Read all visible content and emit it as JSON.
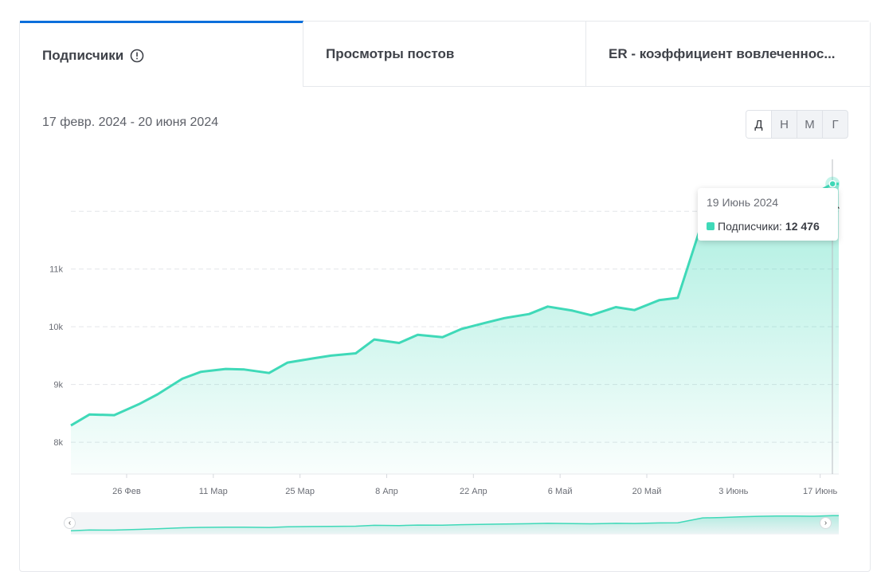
{
  "tabs": [
    {
      "label": "Подписчики"
    },
    {
      "label": "Просмотры постов"
    },
    {
      "label": "ER - коэффициент вовлеченнос..."
    }
  ],
  "date_range": "17 февр. 2024 - 20 июня 2024",
  "periods": [
    "Д",
    "Н",
    "М",
    "Г"
  ],
  "tooltip": {
    "date": "19 Июнь 2024",
    "series": "Подписчики:",
    "value": "12 476"
  },
  "colors": {
    "accent": "#0c6fdb",
    "line": "#3fd9b8"
  },
  "icons": {
    "info": "info-icon",
    "prev": "chevron-left-icon",
    "next": "chevron-right-icon"
  },
  "chart_data": {
    "type": "area",
    "y_ticks": [
      "8k",
      "9k",
      "10k",
      "11k"
    ],
    "x_ticks": [
      "26 Фев",
      "11 Мар",
      "25 Мар",
      "8 Апр",
      "22 Апр",
      "6 Май",
      "20 Май",
      "3 Июнь",
      "17 Июнь"
    ],
    "ylim": [
      7450,
      12900
    ],
    "x": [
      "2024-02-17",
      "2024-02-20",
      "2024-02-24",
      "2024-02-28",
      "2024-03-02",
      "2024-03-06",
      "2024-03-09",
      "2024-03-13",
      "2024-03-16",
      "2024-03-20",
      "2024-03-23",
      "2024-03-27",
      "2024-03-30",
      "2024-04-03",
      "2024-04-06",
      "2024-04-10",
      "2024-04-13",
      "2024-04-17",
      "2024-04-20",
      "2024-04-24",
      "2024-04-27",
      "2024-05-01",
      "2024-05-04",
      "2024-05-08",
      "2024-05-11",
      "2024-05-15",
      "2024-05-18",
      "2024-05-22",
      "2024-05-25",
      "2024-05-29",
      "2024-06-01",
      "2024-06-04",
      "2024-06-07",
      "2024-06-10",
      "2024-06-13",
      "2024-06-16",
      "2024-06-19",
      "2024-06-20"
    ],
    "series": [
      {
        "name": "Подписчики",
        "values": [
          8290,
          8480,
          8470,
          8660,
          8830,
          9100,
          9220,
          9270,
          9260,
          9200,
          9380,
          9450,
          9500,
          9540,
          9780,
          9720,
          9860,
          9820,
          9960,
          10070,
          10150,
          10220,
          10350,
          10280,
          10200,
          10340,
          10290,
          10460,
          10500,
          11830,
          11950,
          12120,
          12280,
          12340,
          12350,
          12300,
          12476,
          12476
        ]
      }
    ]
  }
}
